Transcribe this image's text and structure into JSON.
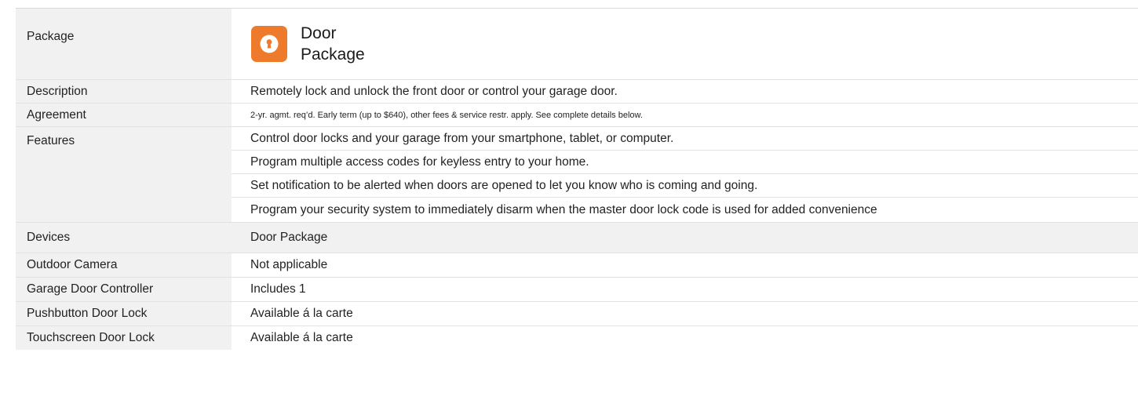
{
  "package": {
    "label": "Package",
    "title_line1": "Door",
    "title_line2": "Package",
    "icon": "keyhole-icon",
    "icon_color": "#ee7a2c"
  },
  "description": {
    "label": "Description",
    "value": "Remotely lock and unlock the front door or control your garage door."
  },
  "agreement": {
    "label": "Agreement",
    "value": "2-yr. agmt. req’d. Early term (up to $640), other fees & service restr. apply. See complete details below."
  },
  "features": {
    "label": "Features",
    "items": [
      "Control door locks and your garage from your smartphone, tablet, or computer.",
      "Program multiple access codes for keyless entry to your home.",
      "Set notification to be alerted when doors are opened to let you know who is coming and going.",
      "Program your security system to immediately disarm when the  master door lock code is used for added convenience"
    ]
  },
  "devices": {
    "label": "Devices",
    "value": "Door Package",
    "rows": [
      {
        "label": "Outdoor Camera",
        "value": "Not applicable"
      },
      {
        "label": "Garage Door Controller",
        "value": "Includes 1"
      },
      {
        "label": "Pushbutton Door Lock",
        "value": "Available á la carte"
      },
      {
        "label": "Touchscreen Door Lock",
        "value": "Available á la carte"
      }
    ]
  },
  "colors": {
    "label_background": "#f1f1f1",
    "accent": "#ee7a2c"
  }
}
